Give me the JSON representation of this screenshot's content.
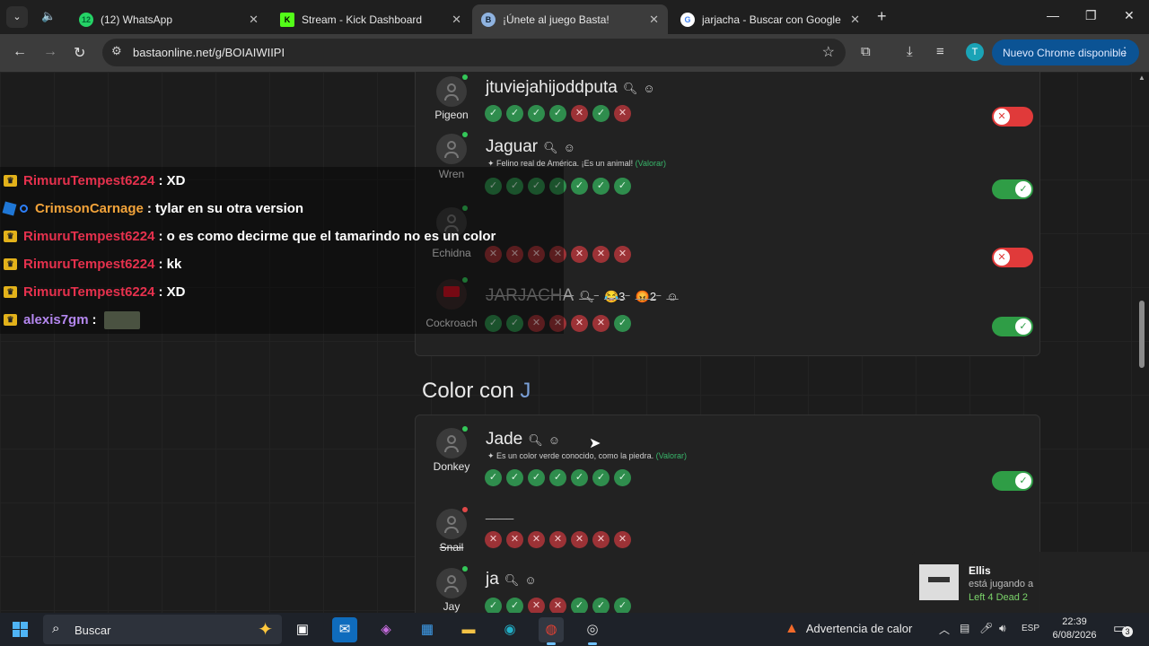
{
  "browser": {
    "tabs": [
      {
        "title": "(12) WhatsApp",
        "badge": "12",
        "active": false
      },
      {
        "title": "Stream - Kick Dashboard",
        "badge": "K",
        "active": false
      },
      {
        "title": "¡Únete al juego Basta!",
        "badge": "B",
        "active": true
      },
      {
        "title": "jarjacha - Buscar con Google",
        "badge": "G",
        "active": false
      }
    ],
    "url": "bastaonline.net/g/BOIAIWIIPI",
    "profile_initial": "T",
    "update_label": "Nuevo Chrome disponible"
  },
  "game": {
    "rows_prev": [
      {
        "player": "Pigeon",
        "answer": "jtuviejahijoddputa",
        "status": "online",
        "strike": false,
        "desc": "",
        "valorar": "",
        "checks": [
          "ok",
          "ok",
          "ok",
          "ok",
          "no",
          "ok",
          "no"
        ],
        "toggle": "off",
        "reactions": []
      },
      {
        "player": "Wren",
        "answer": "Jaguar",
        "status": "online",
        "strike": false,
        "desc": "Felino real de América. ¡Es un animal!",
        "valorar": "(Valorar)",
        "checks": [
          "ok",
          "ok",
          "ok",
          "ok",
          "ok",
          "ok",
          "ok"
        ],
        "toggle": "on",
        "reactions": []
      },
      {
        "player": "Echidna",
        "answer": "",
        "status": "online",
        "strike": false,
        "desc": "",
        "valorar": "",
        "checks": [
          "no",
          "no",
          "no",
          "no",
          "no",
          "no",
          "no"
        ],
        "toggle": "off",
        "reactions": []
      },
      {
        "player": "Cockroach",
        "answer": "JARJACHA",
        "status": "online",
        "strike": true,
        "desc": "",
        "valorar": "",
        "checks": [
          "ok",
          "ok",
          "no",
          "no",
          "no",
          "no",
          "ok"
        ],
        "toggle": "on",
        "reactions": [
          {
            "emoji": "😂",
            "count": "3"
          },
          {
            "emoji": "😡",
            "count": "2"
          }
        ]
      }
    ],
    "section": {
      "prefix": "Color con",
      "letter": "J"
    },
    "rows_color": [
      {
        "player": "Donkey",
        "answer": "Jade",
        "status": "online",
        "strike": false,
        "desc": "Es un color verde conocido, como la piedra.",
        "valorar": "(Valorar)",
        "checks": [
          "ok",
          "ok",
          "ok",
          "ok",
          "ok",
          "ok",
          "ok"
        ],
        "toggle": "on"
      },
      {
        "player": "Snail",
        "answer": "____",
        "status": "offline",
        "strike": false,
        "desc": "",
        "valorar": "",
        "checks": [
          "no",
          "no",
          "no",
          "no",
          "no",
          "no",
          "no"
        ],
        "toggle": "none"
      },
      {
        "player": "Jay",
        "answer": "ja",
        "status": "online",
        "strike": false,
        "desc": "",
        "valorar": "",
        "checks": [
          "ok",
          "ok",
          "no",
          "no",
          "ok",
          "ok",
          "ok"
        ],
        "toggle": "none"
      }
    ]
  },
  "chat": [
    {
      "user": "RimuruTempest6224",
      "text": ": XD",
      "badge": "crown",
      "color": "#e5314d"
    },
    {
      "user": "CrimsonCarnage",
      "text": ": tylar en su otra version",
      "badge": "cube",
      "color": "#f2a33a"
    },
    {
      "user": "RimuruTempest6224",
      "text": ": o es como decirme que el tamarindo no es un color",
      "badge": "crown",
      "color": "#e5314d"
    },
    {
      "user": "RimuruTempest6224",
      "text": ": kk",
      "badge": "crown",
      "color": "#e5314d"
    },
    {
      "user": "RimuruTempest6224",
      "text": ": XD",
      "badge": "crown",
      "color": "#e5314d"
    },
    {
      "user": "alexis7gm",
      "text": ":",
      "badge": "crown",
      "color": "#b487ef",
      "emote": true
    }
  ],
  "notification": {
    "name": "Ellis",
    "line1": "está jugando a",
    "line2": "Left 4 Dead 2"
  },
  "taskbar": {
    "search_label": "Buscar",
    "warning": "Advertencia de calor",
    "lang": "ESP",
    "time": "22:39",
    "date": "6/08/2026",
    "notif_count": "3"
  },
  "icons": {
    "search": "search-icon",
    "smiley_add": "add-reaction-icon",
    "check": "check-icon",
    "cross": "close-icon"
  }
}
